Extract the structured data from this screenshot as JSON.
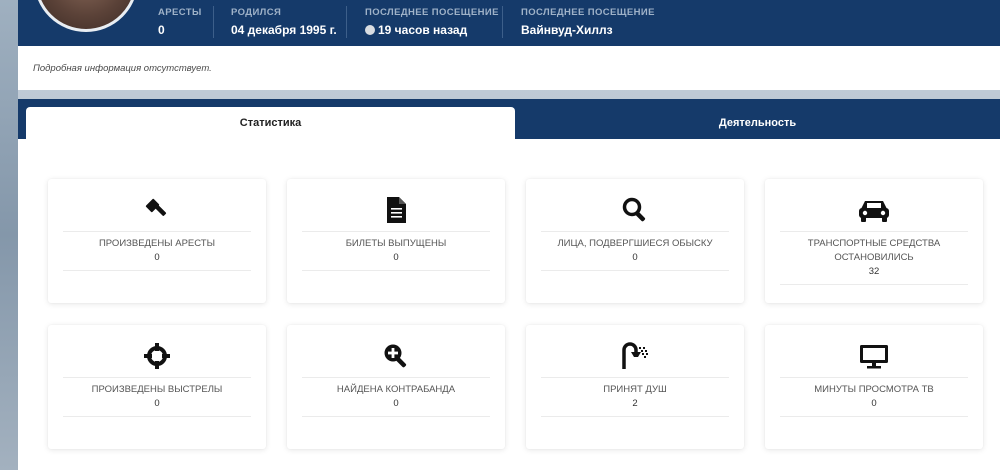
{
  "header": {
    "arrests": {
      "label": "АРЕСТЫ",
      "value": "0"
    },
    "born": {
      "label": "РОДИЛСЯ",
      "value": "04 декабря 1995 г."
    },
    "last_seen_time": {
      "label": "ПОСЛЕДНЕЕ ПОСЕЩЕНИЕ",
      "value": "19 часов назад"
    },
    "last_seen_place": {
      "label": "ПОСЛЕДНЕЕ ПОСЕЩЕНИЕ",
      "value": "Вайнвуд-Хиллз"
    }
  },
  "details": {
    "text": "Подробная информация отсутствует."
  },
  "tabs": [
    {
      "label": "Статистика",
      "active": true
    },
    {
      "label": "Деятельность",
      "active": false
    }
  ],
  "stats": [
    {
      "icon": "gavel-icon",
      "title": "ПРОИЗВЕДЕНЫ АРЕСТЫ",
      "value": "0"
    },
    {
      "icon": "document-icon",
      "title": "БИЛЕТЫ ВЫПУЩЕНЫ",
      "value": "0"
    },
    {
      "icon": "search-icon",
      "title": "ЛИЦА, ПОДВЕРГШИЕСЯ ОБЫСКУ",
      "value": "0"
    },
    {
      "icon": "car-icon",
      "title": "ТРАНСПОРТНЫЕ СРЕДСТВА ОСТАНОВИЛИСЬ",
      "value": "32"
    },
    {
      "icon": "crosshair-icon",
      "title": "ПРОИЗВЕДЕНЫ ВЫСТРЕЛЫ",
      "value": "0"
    },
    {
      "icon": "zoom-in-icon",
      "title": "НАЙДЕНА КОНТРАБАНДА",
      "value": "0"
    },
    {
      "icon": "shower-icon",
      "title": "ПРИНЯТ ДУШ",
      "value": "2"
    },
    {
      "icon": "tv-icon",
      "title": "МИНУТЫ ПРОСМОТРА ТВ",
      "value": "0"
    }
  ],
  "colors": {
    "header_bg": "#153a6a",
    "label": "#9fb2c8",
    "status_dot": "#d9dde2"
  }
}
